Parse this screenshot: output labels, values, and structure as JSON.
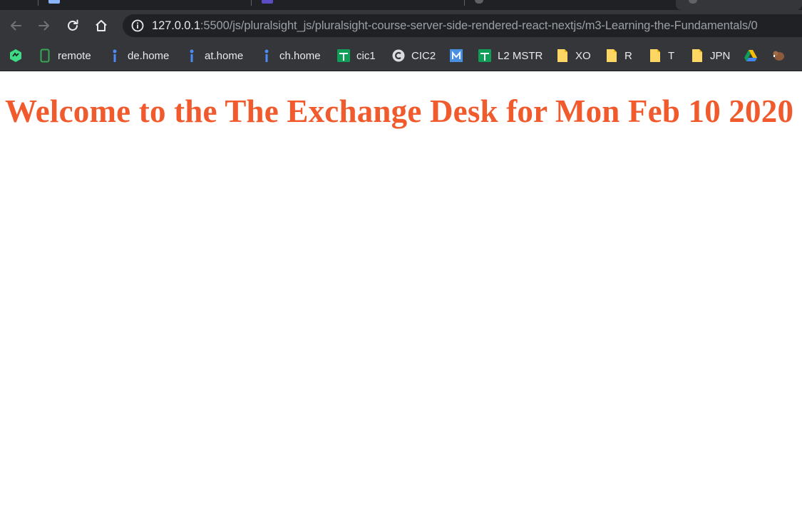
{
  "browser": {
    "tabs": [
      {
        "favicon_color": "#8ab4f8",
        "active": false
      },
      {
        "favicon_color": "#5b4bc4",
        "active": false
      },
      {
        "favicon_color": "#5f6368",
        "active": false
      },
      {
        "favicon_color": "#5f6368",
        "active": true
      }
    ],
    "address_bar": {
      "host": "127.0.0.1",
      "rest": ":5500/js/pluralsight_js/pluralsight-course-server-side-rendered-react-nextjs/m3-Learning-the-Fundamentals/0"
    },
    "bookmarks": [
      {
        "label": "",
        "icon": "spin-logo-icon",
        "color": "#3ddc84"
      },
      {
        "label": "remote",
        "icon": "phone-icon",
        "color": "#34a853"
      },
      {
        "label": "de.home",
        "icon": "info-pin-icon",
        "color": "#4c8bf5"
      },
      {
        "label": "at.home",
        "icon": "info-pin-icon",
        "color": "#4c8bf5"
      },
      {
        "label": "ch.home",
        "icon": "info-pin-icon",
        "color": "#4c8bf5"
      },
      {
        "label": "cic1",
        "icon": "sheets-icon",
        "color": "#0f9d58"
      },
      {
        "label": "CIC2",
        "icon": "c-circle-icon",
        "color": "#e8eaed"
      },
      {
        "label": "",
        "icon": "m-box-icon",
        "color": "#4a90e2"
      },
      {
        "label": "L2 MSTR",
        "icon": "sheets-icon",
        "color": "#0f9d58"
      },
      {
        "label": "XO",
        "icon": "doc-icon",
        "color": "#fdd663"
      },
      {
        "label": "R",
        "icon": "doc-icon",
        "color": "#fdd663"
      },
      {
        "label": "T",
        "icon": "doc-icon",
        "color": "#fdd663"
      },
      {
        "label": "JPN",
        "icon": "doc-icon",
        "color": "#fdd663"
      },
      {
        "label": "",
        "icon": "drive-icon",
        "color": "#fbbc04"
      },
      {
        "label": "",
        "icon": "beaver-icon",
        "color": "#8d5a3b"
      }
    ]
  },
  "page": {
    "heading": "Welcome to the The Exchange Desk for Mon Feb 10 2020",
    "heading_color": "#f05a2c"
  }
}
